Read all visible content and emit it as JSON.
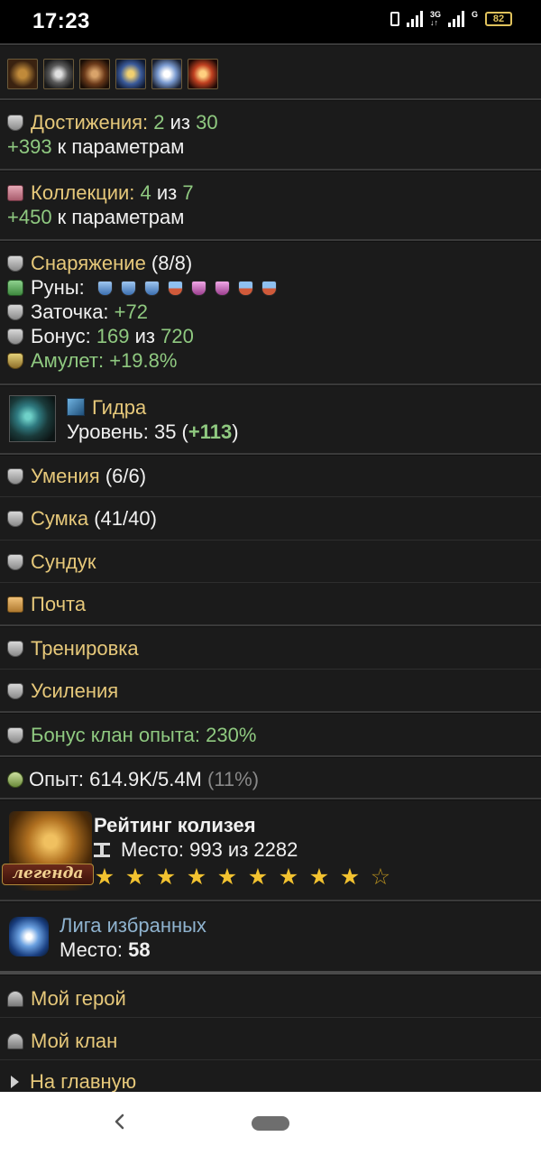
{
  "status": {
    "time": "17:23",
    "network_label_top": "3G",
    "network_label_bottom": "↓↑",
    "network2": "G",
    "battery": "82"
  },
  "achievements": {
    "label": "Достижения: ",
    "count": "2",
    "of": " из ",
    "total": "30",
    "bonus_value": "+393",
    "bonus_suffix": " к параметрам"
  },
  "collections": {
    "label": "Коллекции: ",
    "count": "4",
    "of": " из ",
    "total": "7",
    "bonus_value": "+450",
    "bonus_suffix": " к параметрам"
  },
  "equipment": {
    "label": "Снаряжение",
    "count": " (8/8)",
    "runes_label": "Руны:",
    "sharpening_label": "Заточка: ",
    "sharpening_value": "+72",
    "bonus_label": "Бонус: ",
    "bonus_value": "169",
    "bonus_of": " из ",
    "bonus_total": "720",
    "amulet_label": "Амулет: ",
    "amulet_value": "+19.8%"
  },
  "pet": {
    "name": "Гидра",
    "level_label": "Уровень: 35 (",
    "level_bonus": "+113",
    "level_close": ")"
  },
  "menu": {
    "skills": "Умения",
    "skills_count": " (6/6)",
    "bag": "Сумка",
    "bag_count": " (41/40)",
    "chest": "Сундук",
    "mail": "Почта",
    "training": "Тренировка",
    "boosts": "Усиления",
    "clan_bonus": "Бонус клан опыта: 230%"
  },
  "experience": {
    "text": "Опыт: 614.9K/5.4M",
    "percent": " (11%)"
  },
  "colosseum": {
    "badge": "легенда",
    "title": "Рейтинг колизея",
    "place": "Место: 993 из 2282",
    "stars_full": 9,
    "stars_total": 10
  },
  "league": {
    "title": "Лига избранных",
    "place_label": "Место: ",
    "place_value": "58"
  },
  "links": {
    "my_hero": "Мой герой",
    "my_clan": "Мой клан",
    "home": "На главную"
  }
}
